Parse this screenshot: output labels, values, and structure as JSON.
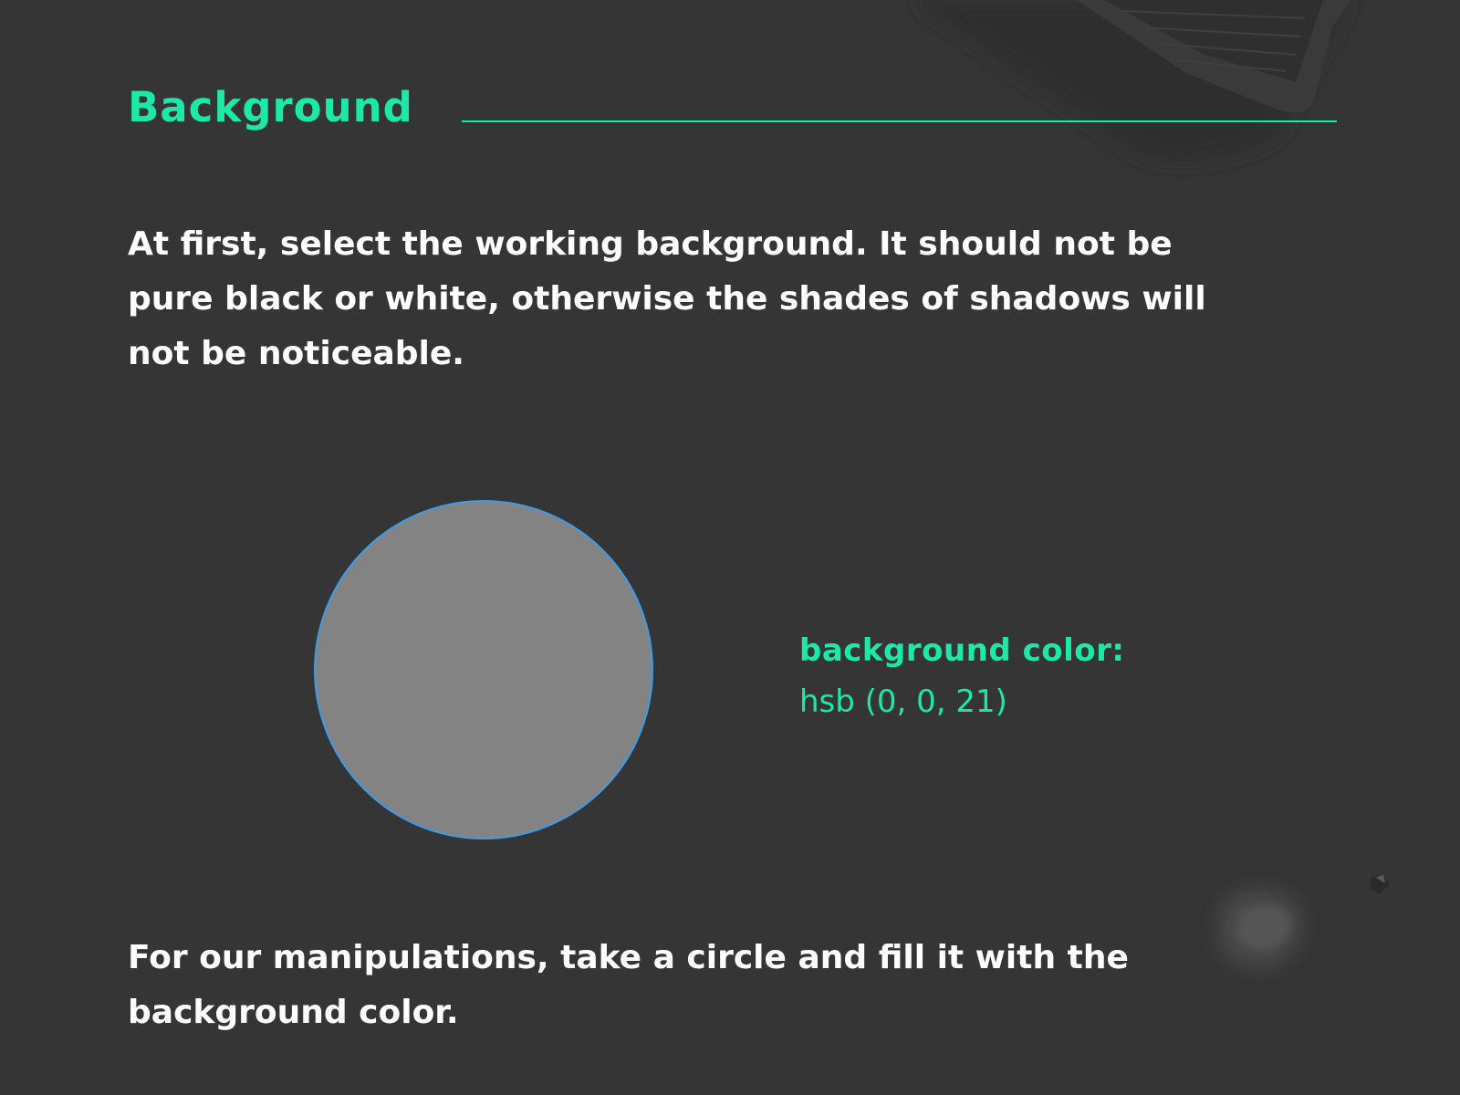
{
  "header": {
    "title": "Background"
  },
  "intro": {
    "text": "At first, select the working background. It should not be pure black or white, otherwise the shades of shadows will not be noticeable."
  },
  "swatch": {
    "label": "background color:",
    "value": "hsb (0, 0, 21)",
    "fill_color": "#838383",
    "outline_color": "#3d9be9"
  },
  "footer": {
    "text": "For our manipulations, take a circle and fill it with the background color."
  },
  "colors": {
    "background": "#353535",
    "accent": "#1de9a6",
    "text": "#ffffff"
  }
}
